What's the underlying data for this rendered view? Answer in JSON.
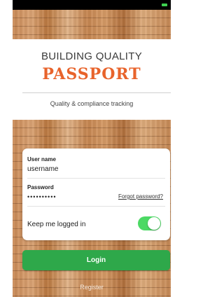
{
  "header": {
    "title_top": "BUILDING QUALITY",
    "title_main": "PASSPORT",
    "subtitle": "Quality & compliance tracking"
  },
  "login": {
    "username_label": "User name",
    "username_value": "username",
    "password_label": "Password",
    "password_value": "••••••••••",
    "forgot_label": "Forgot password?",
    "keep_logged_in_label": "Keep me logged in",
    "keep_logged_in": true,
    "login_button": "Login",
    "register_link": "Register"
  },
  "colors": {
    "accent": "#e8632b",
    "button": "#2ea84a",
    "toggle_on": "#4cd964"
  }
}
